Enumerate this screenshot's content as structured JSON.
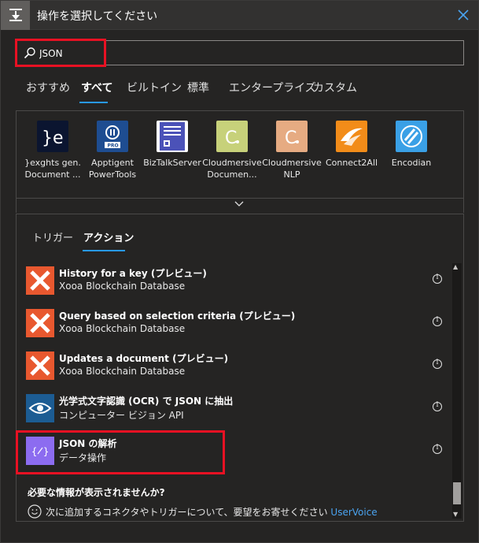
{
  "header": {
    "title": "操作を選択してください"
  },
  "search": {
    "value": "JSON",
    "placeholder": ""
  },
  "tabs": [
    {
      "label": "おすすめ"
    },
    {
      "label": "すべて",
      "active": true
    },
    {
      "label": "ビルトイン"
    },
    {
      "label": "標準"
    },
    {
      "label": "エンタープライズ"
    },
    {
      "label": "カスタム"
    }
  ],
  "connectors": [
    {
      "name": "}exghts gen. Document ...",
      "color": "#0b1530",
      "icon": "exghts-logo"
    },
    {
      "name": "Apptigent PowerTools",
      "color": "#1e4d91",
      "icon": "apptigent-logo"
    },
    {
      "name": "BizTalkServer",
      "color": "#4b52b8",
      "icon": "biztalk-logo"
    },
    {
      "name": "Cloudmersive Documen...",
      "color": "#c7d17a",
      "icon": "cloudmersive-logo"
    },
    {
      "name": "Cloudmersive NLP",
      "color": "#e6ab82",
      "icon": "cloudmersive-logo"
    },
    {
      "name": "Connect2All",
      "color": "#f28c19",
      "icon": "connect2all-logo"
    },
    {
      "name": "Encodian",
      "color": "#3aa0e6",
      "icon": "encodian-logo"
    }
  ],
  "subtabs": [
    {
      "label": "トリガー"
    },
    {
      "label": "アクション",
      "active": true
    }
  ],
  "actions": [
    {
      "title": "History for a key (プレビュー)",
      "subtitle": "Xooa Blockchain Database",
      "icon": "xooa-icon",
      "color": "#e8582f"
    },
    {
      "title": "Query based on selection criteria (プレビュー)",
      "subtitle": "Xooa Blockchain Database",
      "icon": "xooa-icon",
      "color": "#e8582f"
    },
    {
      "title": "Updates a document (プレビュー)",
      "subtitle": "Xooa Blockchain Database",
      "icon": "xooa-icon",
      "color": "#e8582f"
    },
    {
      "title": "光学式文字認識 (OCR) で JSON に抽出",
      "subtitle": "コンピューター ビジョン API",
      "icon": "eye-icon",
      "color": "#1c5c93"
    },
    {
      "title": "JSON の解析",
      "subtitle": "データ操作",
      "icon": "data-operation-icon",
      "color": "#8c6cf0"
    }
  ],
  "missing": {
    "title": "必要な情報が表示されませんか?",
    "text": "次に追加するコネクタやトリガーについて、要望をお寄せください",
    "link": "UserVoice"
  }
}
